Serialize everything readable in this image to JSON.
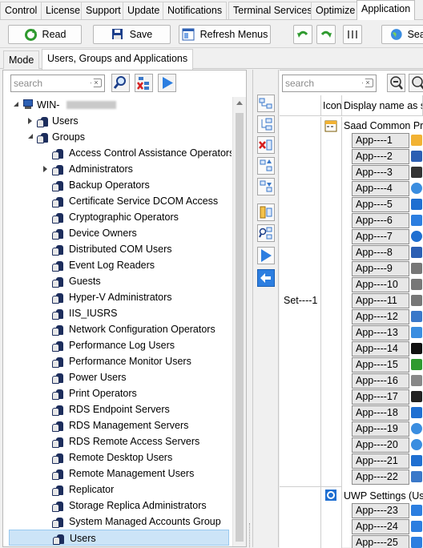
{
  "menu": {
    "tabs": [
      "Control",
      "License",
      "Support",
      "Update",
      "Notifications",
      "Terminal Services",
      "Optimize",
      "Application"
    ],
    "active": "Application"
  },
  "toolbar": {
    "read": "Read",
    "save": "Save",
    "refresh": "Refresh Menus",
    "search": "Sear"
  },
  "subtabs": [
    "Mode",
    "Users, Groups and Applications"
  ],
  "left": {
    "search_placeholder": "search",
    "tree": {
      "root": "WIN-",
      "users": "Users",
      "groups": "Groups",
      "group_items": [
        "Access Control Assistance Operators",
        "Administrators",
        "Backup Operators",
        "Certificate Service DCOM Access",
        "Cryptographic Operators",
        "Device Owners",
        "Distributed COM Users",
        "Event Log Readers",
        "Guests",
        "Hyper-V Administrators",
        "IIS_IUSRS",
        "Network Configuration Operators",
        "Performance Log Users",
        "Performance Monitor Users",
        "Power Users",
        "Print Operators",
        "RDS Endpoint Servers",
        "RDS Management Servers",
        "RDS Remote Access Servers",
        "Remote Desktop Users",
        "Remote Management Users",
        "Replicator",
        "Storage Replica Administrators",
        "System Managed Accounts Group",
        "Users"
      ],
      "selected": "Users"
    }
  },
  "right": {
    "search_placeholder": "search",
    "columns": {
      "icon": "Icon",
      "display": "Display name as sh"
    },
    "set_label": "Set----1",
    "group1": "Saad Common Pro",
    "group2": "UWP Settings (User",
    "apps": [
      "App----1",
      "App----2",
      "App----3",
      "App----4",
      "App----5",
      "App----6",
      "App----7",
      "App----8",
      "App----9",
      "App----10",
      "App----11",
      "App----12",
      "App----13",
      "App----14",
      "App----15",
      "App----16",
      "App----17",
      "App----18",
      "App----19",
      "App----20",
      "App----21",
      "App----22",
      "App----23",
      "App----24",
      "App----25"
    ],
    "app_icons": [
      "folder-icon",
      "display-icon",
      "pen-icon",
      "globe-icon",
      "windows-icon",
      "settings-icon",
      "info-icon",
      "monitor-icon",
      "bars-icon",
      "bars-icon",
      "bars-icon",
      "window-icon",
      "network-icon",
      "terminal-icon",
      "tools-icon",
      "printer-icon",
      "qr-icon",
      "media-icon",
      "globe-icon",
      "globe-icon",
      "gear-icon",
      "window-icon",
      "sync-icon",
      "sync-icon",
      "sync-icon"
    ]
  }
}
